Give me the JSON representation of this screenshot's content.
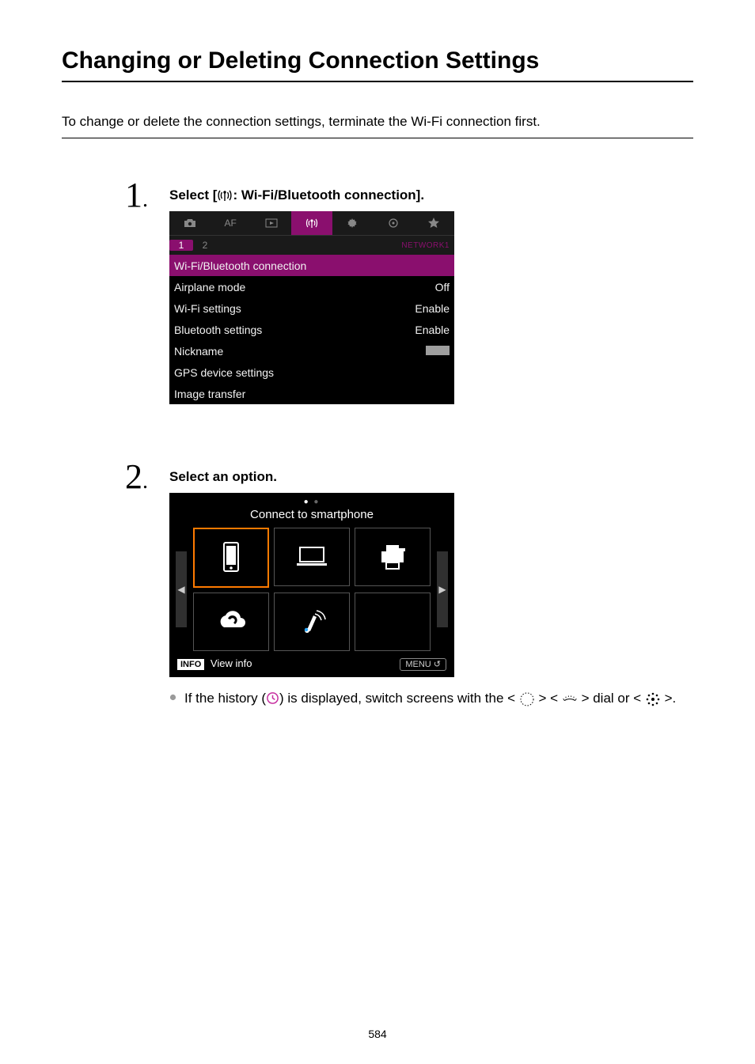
{
  "page": {
    "title": "Changing or Deleting Connection Settings",
    "intro": "To change or delete the connection settings, terminate the Wi-Fi connection first.",
    "number": "584"
  },
  "steps": [
    {
      "num": "1",
      "label_pre": "Select [",
      "label_post": ": Wi-Fi/Bluetooth connection].",
      "cam1": {
        "net_label": "NETWORK1",
        "subtabs": [
          "1",
          "2"
        ],
        "rows": [
          {
            "label": "Wi-Fi/Bluetooth connection",
            "value": "",
            "selected": true
          },
          {
            "label": "Airplane mode",
            "value": "Off"
          },
          {
            "label": "Wi-Fi settings",
            "value": "Enable"
          },
          {
            "label": "Bluetooth settings",
            "value": "Enable"
          },
          {
            "label": "Nickname",
            "value_obscured": true
          },
          {
            "label": "GPS device settings",
            "value": ""
          },
          {
            "label": "Image transfer",
            "value": ""
          }
        ]
      }
    },
    {
      "num": "2",
      "label": "Select an option.",
      "cam2": {
        "title": "Connect to smartphone",
        "footer_info": "INFO",
        "footer_view": "View info",
        "footer_menu": "MENU",
        "cells": [
          "smartphone",
          "computer",
          "printer",
          "cloud",
          "remote",
          "empty"
        ]
      },
      "bullet": {
        "pre": "If the history (",
        "mid": ") is displayed, switch screens with the < ",
        "mid2": " > < ",
        "mid3": " > dial or < ",
        "post": " >."
      }
    }
  ]
}
